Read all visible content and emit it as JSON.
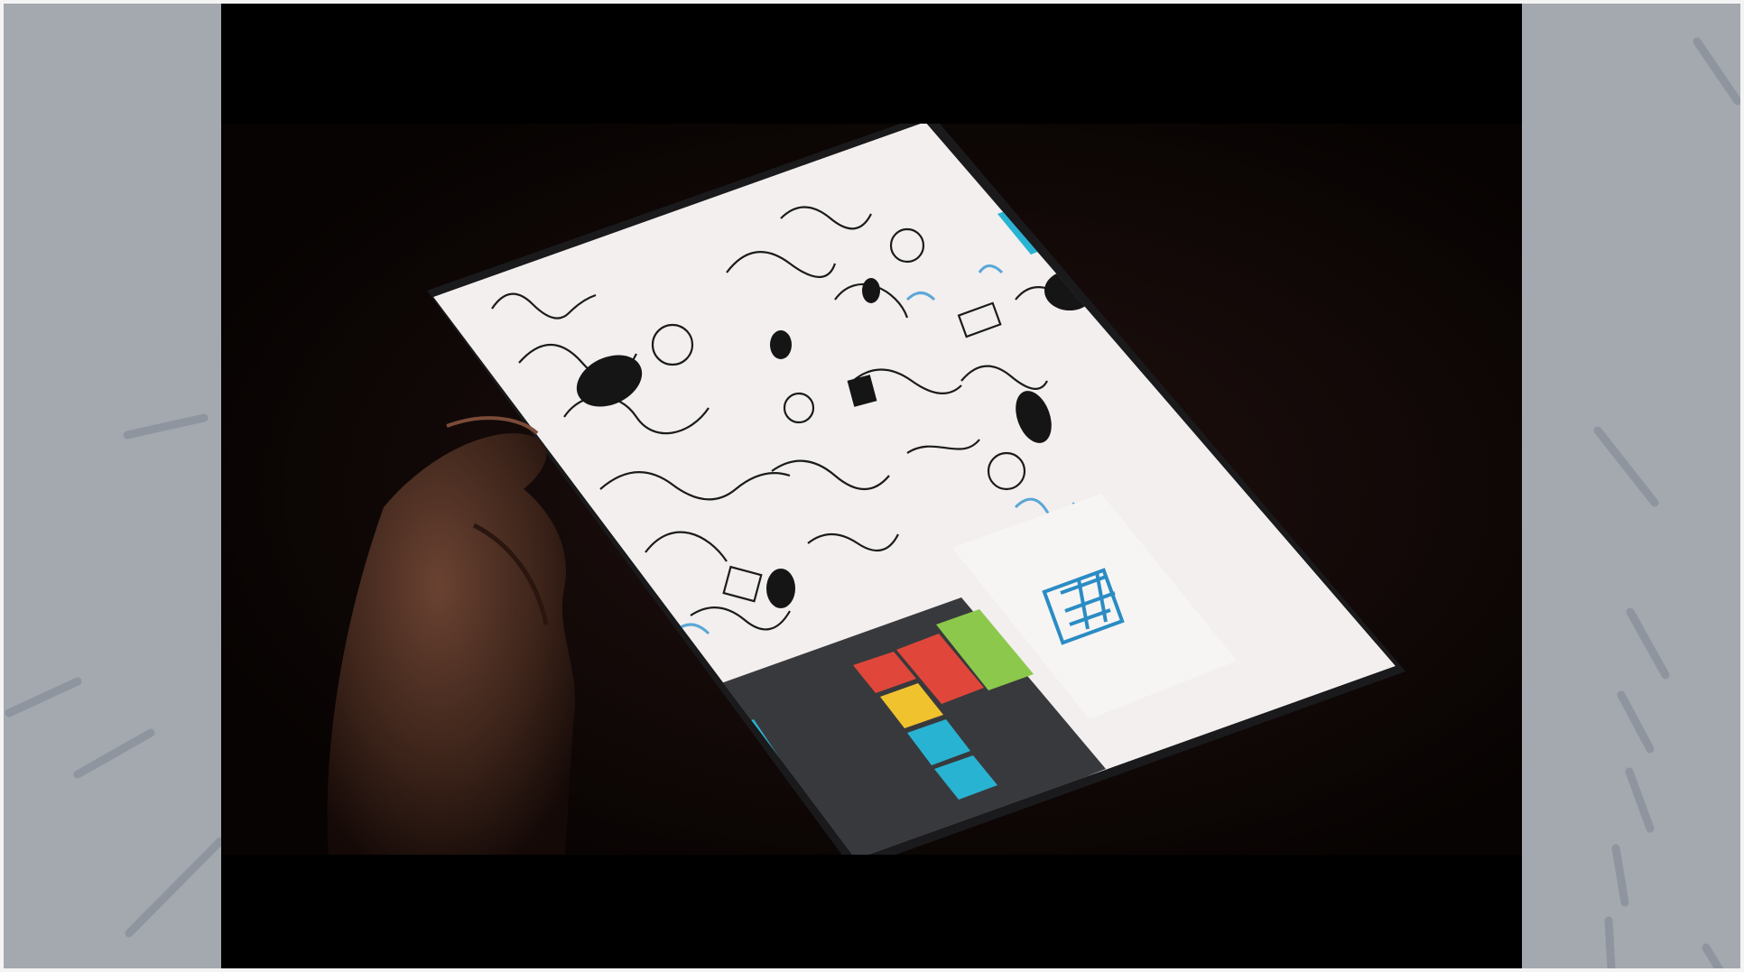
{
  "image": {
    "subject": "video-still",
    "colors": {
      "backdrop": "#a4a9b0",
      "backdrop_strokes": "#8f959e",
      "letterbox": "#000000",
      "scene": "#0d0605",
      "tablet_screen": "#f2efee",
      "tile_red": "#e0473a",
      "tile_green": "#8cc84b",
      "tile_yellow": "#f0c22e",
      "tile_cyan": "#29b3d2",
      "sidebar_dark": "#3d3f44"
    }
  }
}
